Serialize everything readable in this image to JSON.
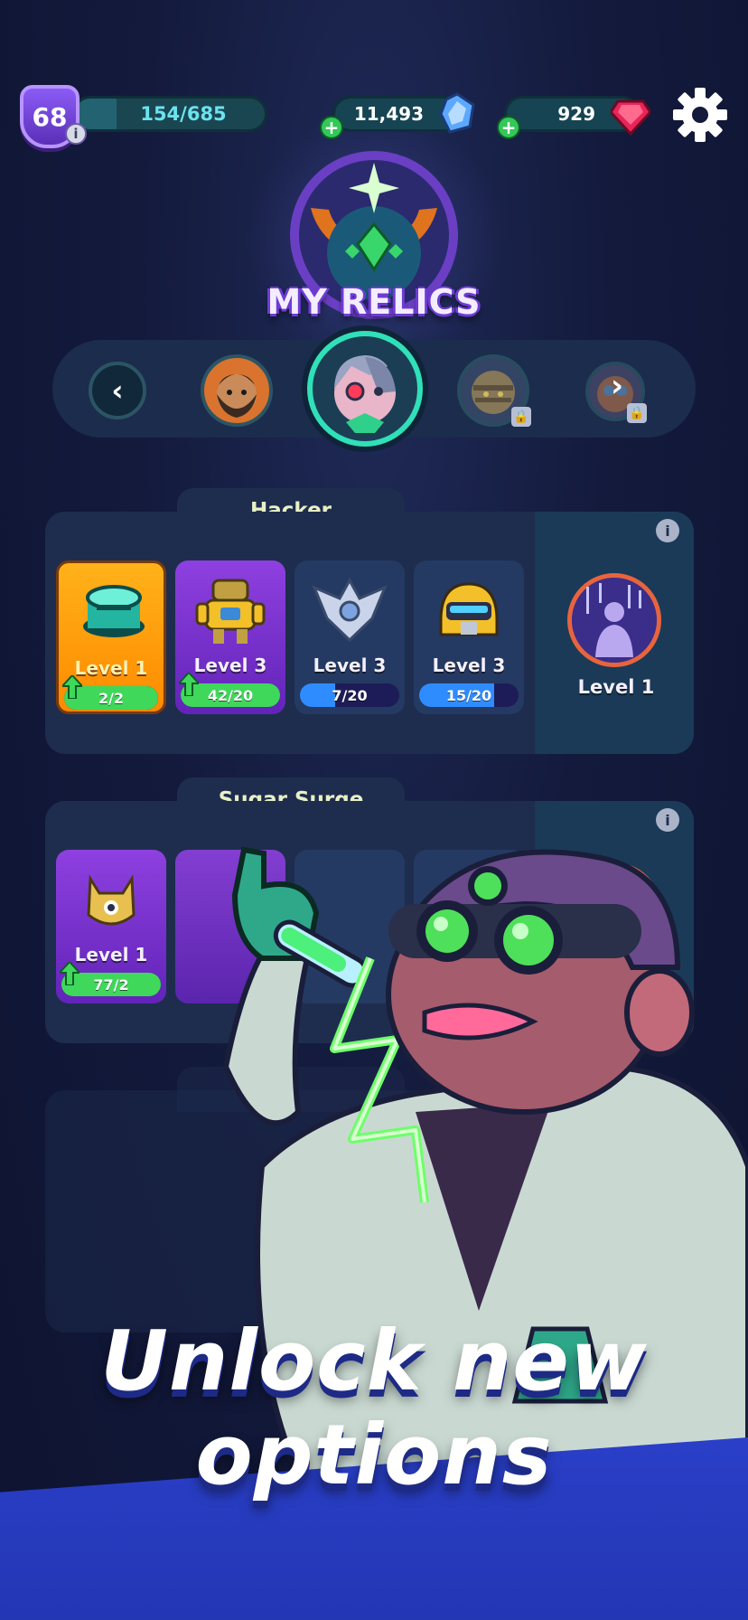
{
  "top_bar": {
    "player_level": "68",
    "xp_text": "154/685",
    "xp_progress": 0.22,
    "blue_currency": "11,493",
    "gems": "929"
  },
  "header": {
    "title": "MY RELICS"
  },
  "carousel": {
    "heroes": [
      "hero-bearded-fighter",
      "hero-cyborg-hacker",
      "hero-locked-mummy",
      "hero-locked-goggles"
    ],
    "selected_index": 1
  },
  "panels": [
    {
      "name": "Hacker",
      "cards": [
        {
          "level": "Level 1",
          "progress": "2/2",
          "fill": 1.0,
          "style": "orange",
          "bar": "green",
          "upgrade": true
        },
        {
          "level": "Level 3",
          "progress": "42/20",
          "fill": 1.0,
          "style": "purple",
          "bar": "green",
          "upgrade": true
        },
        {
          "level": "Level 3",
          "progress": "7/20",
          "fill": 0.35,
          "style": "navy",
          "bar": "blue",
          "upgrade": false
        },
        {
          "level": "Level 3",
          "progress": "15/20",
          "fill": 0.75,
          "style": "navy",
          "bar": "blue",
          "upgrade": false
        }
      ],
      "ultimate_level": "Level 1"
    },
    {
      "name": "Sugar Surge",
      "cards": [
        {
          "level": "Level 1",
          "progress": "77/2",
          "fill": 1.0,
          "style": "purple",
          "bar": "green",
          "upgrade": true
        }
      ]
    }
  ],
  "colors": {
    "background": "#131a3c",
    "panel": "#1e2d4e",
    "accent_green": "#3fd85a",
    "accent_blue": "#2f8cff",
    "title_outline": "#6f3bd6"
  },
  "headline": {
    "line1": "Unlock new",
    "line2": "options"
  }
}
